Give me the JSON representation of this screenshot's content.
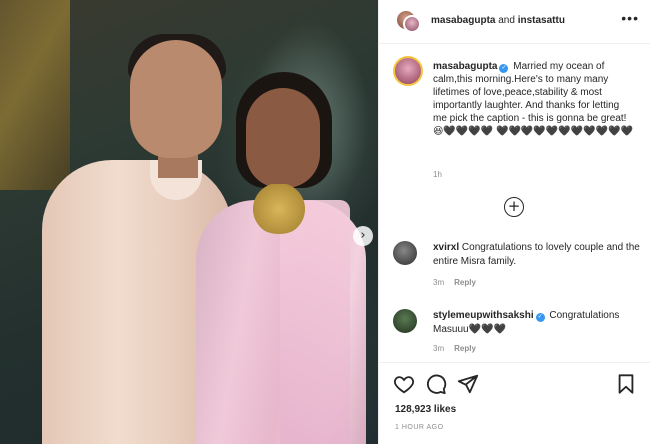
{
  "header": {
    "user1": "masabagupta",
    "joiner": " and ",
    "user2": "instasattu",
    "more_icon": "more-horizontal-icon"
  },
  "caption": {
    "username": "masabagupta",
    "text": "Married my ocean of calm,this morning.Here's to many many lifetimes of love,peace,stability & most importantly laughter. And thanks for letting me pick the caption - this is gonna be great! 😆🖤🖤🖤🖤",
    "hearts": "🖤🖤🖤🖤🖤🖤🖤🖤🖤🖤🖤",
    "time": "1h"
  },
  "load_more_icon": "plus-circle-icon",
  "carousel_next_icon": "chevron-right-icon",
  "comments": [
    {
      "username": "xvirxl",
      "text": "Congratulations to lovely couple and the entire Misra family.",
      "time": "3m",
      "reply": "Reply"
    },
    {
      "username": "stylemeupwithsakshi",
      "text": "Congratulations Masuuu🖤🖤🖤",
      "time": "3m",
      "reply": "Reply"
    }
  ],
  "actions": {
    "like_icon": "heart-icon",
    "comment_icon": "comment-icon",
    "share_icon": "send-icon",
    "save_icon": "bookmark-icon"
  },
  "likes": "128,923 likes",
  "posted": "1 HOUR AGO",
  "colors": {
    "verified": "#3897f0",
    "muted": "#8e8e8e",
    "text": "#262626",
    "border": "#efefef"
  }
}
